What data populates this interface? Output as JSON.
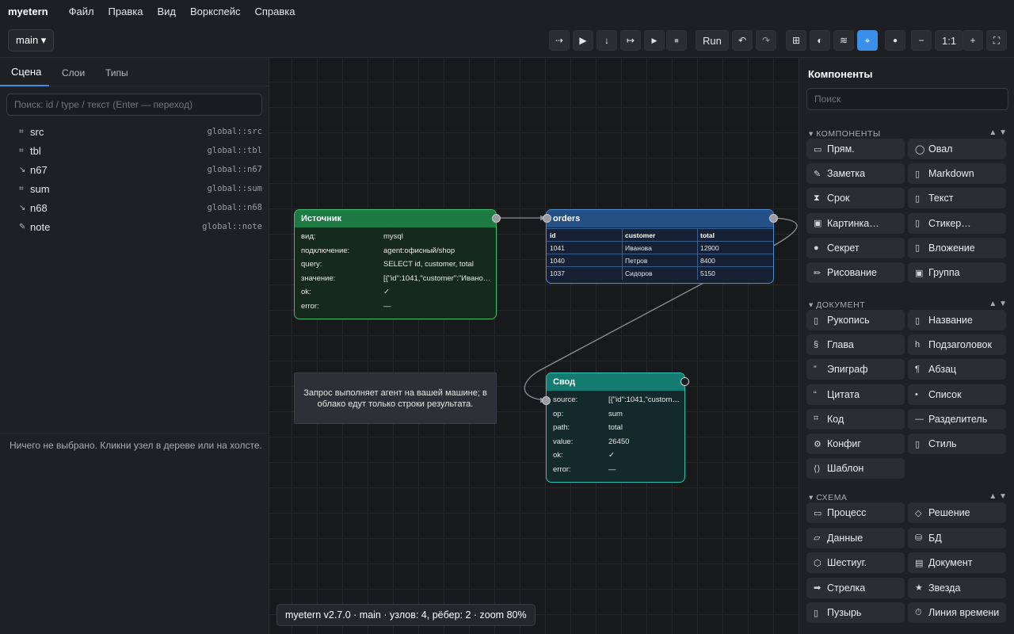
{
  "menubar": {
    "brand": "myetern",
    "items": [
      "Файл",
      "Правка",
      "Вид",
      "Воркспейс",
      "Справка"
    ]
  },
  "toolbar": {
    "branch": "main ▾",
    "run_label": "Run",
    "zoom_reset": "1:1"
  },
  "left_panel": {
    "tabs": [
      "Сцена",
      "Слои",
      "Типы"
    ],
    "search_placeholder": "Поиск: id / type / текст (Enter — переход)",
    "tree": [
      {
        "icon": "⌗",
        "name": "src",
        "path": "global::src"
      },
      {
        "icon": "⌗",
        "name": "tbl",
        "path": "global::tbl"
      },
      {
        "icon": "↘",
        "name": "n67",
        "path": "global::n67"
      },
      {
        "icon": "⌗",
        "name": "sum",
        "path": "global::sum"
      },
      {
        "icon": "↘",
        "name": "n68",
        "path": "global::n68"
      },
      {
        "icon": "✎",
        "name": "note",
        "path": "global::note"
      }
    ],
    "empty_note": "Ничего не выбрано. Кликни узел в дереве или на холсте."
  },
  "canvas": {
    "source_node": {
      "title": "Источник",
      "rows": [
        {
          "key": "вид:",
          "value": "mysql"
        },
        {
          "key": "подключение:",
          "value": "agent:офисный/shop"
        },
        {
          "key": "query:",
          "value": "SELECT id, customer, total"
        },
        {
          "key": "значение:",
          "value": "[{\"id\":1041,\"customer\":\"Иванова\"..."
        },
        {
          "key": "ok:",
          "value": "✓"
        },
        {
          "key": "error:",
          "value": "—"
        }
      ]
    },
    "table_node": {
      "title": "orders",
      "columns": [
        "id",
        "customer",
        "total"
      ],
      "rows": [
        [
          "1041",
          "Иванова",
          "12900"
        ],
        [
          "1040",
          "Петров",
          "8400"
        ],
        [
          "1037",
          "Сидоров",
          "5150"
        ]
      ]
    },
    "sum_node": {
      "title": "Свод",
      "rows": [
        {
          "key": "source:",
          "value": "[{\"id\":1041,\"customer\"..."
        },
        {
          "key": "op:",
          "value": "sum"
        },
        {
          "key": "path:",
          "value": "total"
        },
        {
          "key": "value:",
          "value": "26450"
        },
        {
          "key": "ok:",
          "value": "✓"
        },
        {
          "key": "error:",
          "value": "—"
        }
      ]
    },
    "note_text": "Запрос выполняет агент на вашей машине; в облако едут только строки результата.",
    "status": "myetern v2.7.0 · main · узлов: 4, рёбер: 2 · zoom 80%"
  },
  "right_panel": {
    "title": "Компоненты",
    "search_placeholder": "Поиск",
    "sections": [
      {
        "title": "▾ КОМПОНЕНТЫ",
        "items": [
          {
            "icon": "▭",
            "label": "Прям."
          },
          {
            "icon": "◯",
            "label": "Овал"
          },
          {
            "icon": "✎",
            "label": "Заметка"
          },
          {
            "icon": "▯",
            "label": "Markdown"
          },
          {
            "icon": "⧗",
            "label": "Срок"
          },
          {
            "icon": "▯",
            "label": "Текст"
          },
          {
            "icon": "▣",
            "label": "Картинка…"
          },
          {
            "icon": "▯",
            "label": "Стикер…"
          },
          {
            "icon": "●",
            "label": "Секрет"
          },
          {
            "icon": "▯",
            "label": "Вложение"
          },
          {
            "icon": "✏",
            "label": "Рисование"
          },
          {
            "icon": "▣",
            "label": "Группа"
          }
        ]
      },
      {
        "title": "▾ ДОКУМЕНТ",
        "items": [
          {
            "icon": "▯",
            "label": "Рукопись"
          },
          {
            "icon": "▯",
            "label": "Название"
          },
          {
            "icon": "§",
            "label": "Глава"
          },
          {
            "icon": "h",
            "label": "Подзаголовок"
          },
          {
            "icon": "”",
            "label": "Эпиграф"
          },
          {
            "icon": "¶",
            "label": "Абзац"
          },
          {
            "icon": "“",
            "label": "Цитата"
          },
          {
            "icon": "•",
            "label": "Список"
          },
          {
            "icon": "⌗",
            "label": "Код"
          },
          {
            "icon": "—",
            "label": "Разделитель"
          },
          {
            "icon": "⚙",
            "label": "Конфиг"
          },
          {
            "icon": "▯",
            "label": "Стиль"
          },
          {
            "icon": "⟨⟩",
            "label": "Шаблон"
          }
        ]
      },
      {
        "title": "▾ СХЕМА",
        "items": [
          {
            "icon": "▭",
            "label": "Процесс"
          },
          {
            "icon": "◇",
            "label": "Решение"
          },
          {
            "icon": "▱",
            "label": "Данные"
          },
          {
            "icon": "⛁",
            "label": "БД"
          },
          {
            "icon": "⬡",
            "label": "Шестиуг."
          },
          {
            "icon": "▤",
            "label": "Документ"
          },
          {
            "icon": "➡",
            "label": "Стрелка"
          },
          {
            "icon": "★",
            "label": "Звезда"
          },
          {
            "icon": "▯",
            "label": "Пузырь"
          },
          {
            "icon": "⏱",
            "label": "Линия времени"
          }
        ]
      }
    ]
  },
  "colors": {
    "accent": "#3b8fe8",
    "source_node": "#1e7a43",
    "table_node": "#245086",
    "sum_node": "#157a70"
  }
}
